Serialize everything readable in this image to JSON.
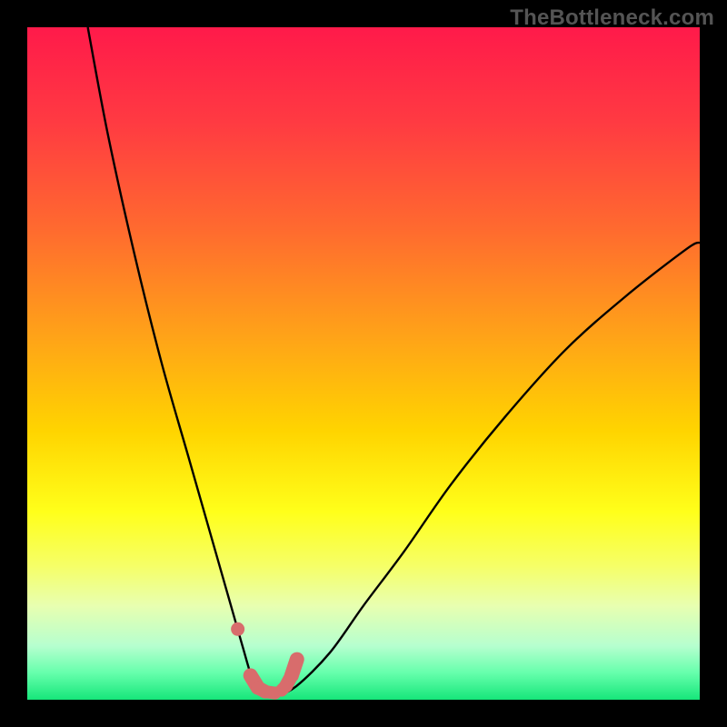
{
  "watermark": "TheBottleneck.com",
  "chart_data": {
    "type": "line",
    "title": "",
    "xlabel": "",
    "ylabel": "",
    "xlim": [
      0,
      100
    ],
    "ylim": [
      0,
      100
    ],
    "series": [
      {
        "name": "bottleneck-curve",
        "x": [
          9,
          12,
          16,
          20,
          24,
          28,
          30,
          32,
          33.5,
          34.8,
          36,
          37,
          40,
          45,
          50,
          56,
          63,
          71,
          80,
          89,
          98,
          100
        ],
        "y": [
          100,
          84,
          66,
          50,
          36,
          22,
          15,
          8,
          3,
          0.8,
          0.5,
          0.6,
          2,
          7,
          14,
          22,
          32,
          42,
          52,
          60,
          67,
          68
        ]
      },
      {
        "name": "marker-overlay",
        "x": [
          31.3,
          33.2,
          34.3,
          35.4,
          36.8,
          37.8,
          38.5,
          39.3,
          40.1
        ],
        "y": [
          10.5,
          3.6,
          1.8,
          1.2,
          1.0,
          1.4,
          2.1,
          3.6,
          6.0
        ]
      }
    ],
    "gradient_stops": [
      {
        "offset": 0,
        "color": "#ff1a4a"
      },
      {
        "offset": 14,
        "color": "#ff3a42"
      },
      {
        "offset": 30,
        "color": "#ff6a2f"
      },
      {
        "offset": 46,
        "color": "#ffa318"
      },
      {
        "offset": 60,
        "color": "#ffd400"
      },
      {
        "offset": 72,
        "color": "#ffff1a"
      },
      {
        "offset": 80,
        "color": "#f6ff66"
      },
      {
        "offset": 86,
        "color": "#e8ffb0"
      },
      {
        "offset": 92,
        "color": "#b6ffcf"
      },
      {
        "offset": 96,
        "color": "#66ffac"
      },
      {
        "offset": 100,
        "color": "#16e67a"
      }
    ],
    "marker_color": "#d86c6c",
    "curve_color": "#000000"
  }
}
